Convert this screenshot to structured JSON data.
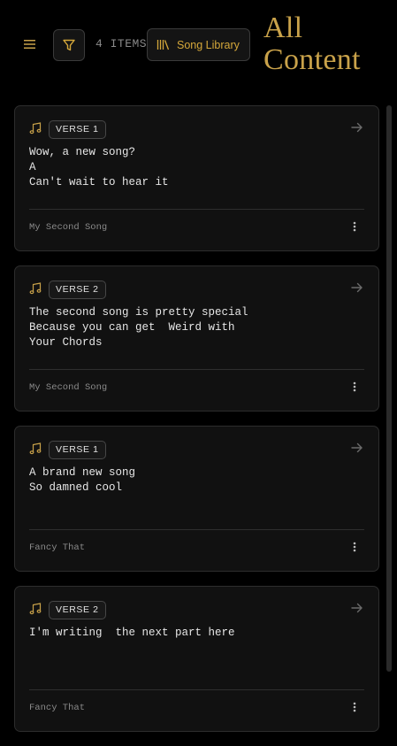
{
  "header": {
    "menu_icon": "hamburger-menu-icon",
    "filter_icon": "filter-funnel-icon",
    "items_count": "4 ITEMS",
    "library_icon": "library-books-icon",
    "library_label": "Song Library",
    "title": "All Content"
  },
  "colors": {
    "background": "#000000",
    "card": "#111111",
    "accent": "#c9a24a",
    "border": "#2d2d2d"
  },
  "cards": [
    {
      "badge": "VERSE 1",
      "lyrics": "Wow, a new song?\nA\nCan't wait to hear it",
      "song": "My Second Song"
    },
    {
      "badge": "VERSE 2",
      "lyrics": "The second song is pretty special\nBecause you can get  Weird with\nYour Chords",
      "song": "My Second Song"
    },
    {
      "badge": "VERSE 1",
      "lyrics": "A brand new song\nSo damned cool",
      "song": "Fancy That"
    },
    {
      "badge": "VERSE 2",
      "lyrics": "I'm writing  the next part here",
      "song": "Fancy That"
    }
  ]
}
